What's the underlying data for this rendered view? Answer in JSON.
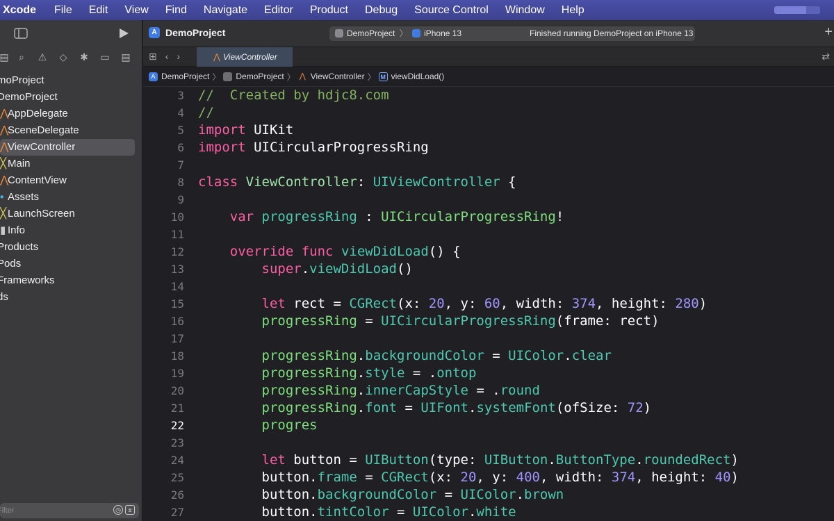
{
  "menubar": {
    "app": "Xcode",
    "items": [
      "File",
      "Edit",
      "View",
      "Find",
      "Navigate",
      "Editor",
      "Product",
      "Debug",
      "Source Control",
      "Window",
      "Help"
    ]
  },
  "sidebar": {
    "tree": [
      {
        "label": "moProject",
        "icon": ""
      },
      {
        "label": "DemoProject",
        "icon": ""
      },
      {
        "label": "AppDelegate",
        "icon": "swift-file-icon"
      },
      {
        "label": "SceneDelegate",
        "icon": "swift-file-icon"
      },
      {
        "label": "ViewController",
        "icon": "swift-file-icon",
        "selected": true
      },
      {
        "label": "Main",
        "icon": "storyboard-icon"
      },
      {
        "label": "ContentView",
        "icon": "swift-file-icon"
      },
      {
        "label": "Assets",
        "icon": "assets-icon"
      },
      {
        "label": "LaunchScreen",
        "icon": "storyboard-icon"
      },
      {
        "label": "Info",
        "icon": "plist-icon"
      },
      {
        "label": "Products",
        "icon": ""
      },
      {
        "label": "Pods",
        "icon": ""
      },
      {
        "label": "Frameworks",
        "icon": ""
      },
      {
        "label": "ds",
        "icon": ""
      }
    ],
    "filter_placeholder": "Filter"
  },
  "toolbar": {
    "project": "DemoProject",
    "scheme": "DemoProject",
    "device": "iPhone 13",
    "status": "Finished running DemoProject on iPhone 13"
  },
  "tab": {
    "active": "ViewController"
  },
  "jumpbar": [
    "DemoProject",
    "DemoProject",
    "ViewController",
    "viewDidLoad()"
  ],
  "code": {
    "lines": [
      {
        "n": "3",
        "html": "<span class='cm'>//  Created by hdjc8.com</span>"
      },
      {
        "n": "4",
        "html": "<span class='cm'>//</span>"
      },
      {
        "n": "5",
        "html": "<span class='kw'>import</span> UIKit"
      },
      {
        "n": "6",
        "html": "<span class='kw'>import</span> UICircularProgressRing"
      },
      {
        "n": "7",
        "html": ""
      },
      {
        "n": "8",
        "html": "<span class='kw'>class</span> <span class='ident'>ViewController</span>: <span class='teal'>UIViewController</span> {"
      },
      {
        "n": "9",
        "html": ""
      },
      {
        "n": "10",
        "html": "    <span class='kw'>var</span> <span class='teal'>progressRing</span> : <span class='green'>UICircularProgressRing</span>!"
      },
      {
        "n": "11",
        "html": ""
      },
      {
        "n": "12",
        "html": "    <span class='kw'>override</span> <span class='kw'>func</span> <span class='teal'>viewDidLoad</span>() {"
      },
      {
        "n": "13",
        "html": "        <span class='kw'>super</span>.<span class='teal'>viewDidLoad</span>()"
      },
      {
        "n": "14",
        "html": ""
      },
      {
        "n": "15",
        "html": "        <span class='kw'>let</span> rect = <span class='teal'>CGRect</span>(x: <span class='num'>20</span>, y: <span class='num'>60</span>, width: <span class='num'>374</span>, height: <span class='num'>280</span>)"
      },
      {
        "n": "16",
        "html": "        <span class='green'>progressRing</span> = <span class='teal'>UICircularProgressRing</span>(frame: rect)"
      },
      {
        "n": "17",
        "html": ""
      },
      {
        "n": "18",
        "html": "        <span class='green'>progressRing</span>.<span class='teal'>backgroundColor</span> = <span class='teal'>UIColor</span>.<span class='teal'>clear</span>"
      },
      {
        "n": "19",
        "html": "        <span class='green'>progressRing</span>.<span class='teal'>style</span> = .<span class='teal'>ontop</span>"
      },
      {
        "n": "20",
        "html": "        <span class='green'>progressRing</span>.<span class='teal'>innerCapStyle</span> = .<span class='teal'>round</span>"
      },
      {
        "n": "21",
        "html": "        <span class='green'>progressRing</span>.<span class='teal'>font</span> = <span class='teal'>UIFont</span>.<span class='teal'>systemFont</span>(ofSize: <span class='num'>72</span>)"
      },
      {
        "n": "22",
        "html": "        <span class='green'>progres</span>",
        "current": true
      },
      {
        "n": "23",
        "html": ""
      },
      {
        "n": "24",
        "html": "        <span class='kw'>let</span> button = <span class='teal'>UIButton</span>(type: <span class='teal'>UIButton</span>.<span class='teal'>ButtonType</span>.<span class='teal'>roundedRect</span>)"
      },
      {
        "n": "25",
        "html": "        button.<span class='teal'>frame</span> = <span class='teal'>CGRect</span>(x: <span class='num'>20</span>, y: <span class='num'>400</span>, width: <span class='num'>374</span>, height: <span class='num'>40</span>)"
      },
      {
        "n": "26",
        "html": "        button.<span class='teal'>backgroundColor</span> = <span class='teal'>UIColor</span>.<span class='teal'>brown</span>"
      },
      {
        "n": "27",
        "html": "        button.<span class='teal'>tintColor</span> = <span class='teal'>UIColor</span>.<span class='teal'>white</span>"
      }
    ]
  }
}
